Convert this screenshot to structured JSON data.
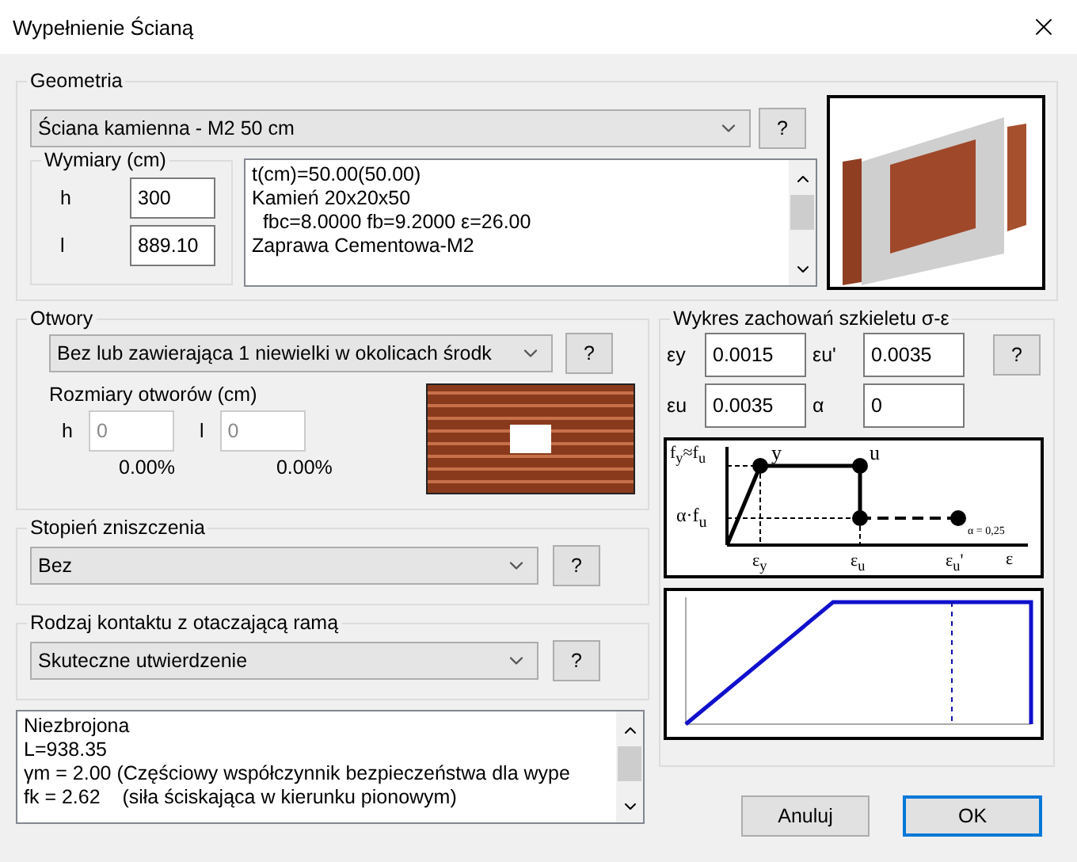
{
  "window": {
    "title": "Wypełnienie Ścianą"
  },
  "geometry": {
    "title": "Geometria",
    "wall_type": "Ściana kamienna - M2 50 cm",
    "help": "?",
    "dimensions": {
      "title": "Wymiary (cm)",
      "fields": [
        {
          "label": "h",
          "value": "300"
        },
        {
          "label": "l",
          "value": "889.10"
        }
      ]
    },
    "properties": [
      "t(cm)=50.00(50.00)",
      "Kamień 20x20x50",
      "  fbc=8.0000 fb=9.2000 ε=26.00",
      "Zaprawa Cementowa-M2"
    ]
  },
  "openings": {
    "title": "Otwory",
    "type": "Bez lub zawierająca 1  niewielki w okolicach środk",
    "help": "?",
    "sizes_title": "Rozmiary otworów (cm)",
    "fields": [
      {
        "label": "h",
        "value": "0",
        "percent": "0.00%",
        "disabled": true
      },
      {
        "label": "l",
        "value": "0",
        "percent": "0.00%",
        "disabled": true
      }
    ]
  },
  "damage": {
    "title": "Stopień zniszczenia",
    "value": "Bez",
    "help": "?"
  },
  "contact": {
    "title": "Rodzaj kontaktu z otaczającą ramą",
    "value": "Skuteczne utwierdzenie",
    "help": "?"
  },
  "notes": [
    "Niezbrojona",
    "L=938.35",
    "γm = 2.00 (Częściowy współczynnik bezpieczeństwa dla wype",
    "fk = 2.62    (siła ściskająca w kierunku pionowym)"
  ],
  "behavior": {
    "title": "Wykres zachowań szkieletu σ-ε",
    "help": "?",
    "fields": [
      {
        "label": "εy",
        "value": "0.0015"
      },
      {
        "label": "εu'",
        "value": "0.0035"
      },
      {
        "label": "εu",
        "value": "0.0035"
      },
      {
        "label": "α",
        "value": "0"
      }
    ],
    "diagram_labels": {
      "fy": "f$_{y}$≈f$_{u}$",
      "y": "y",
      "u": "u",
      "afu": "α·f$_{u}$",
      "ey": "ε$_{y}$",
      "eu": "ε$_{u}$",
      "eu2": "ε$_{u}$'",
      "e": "ε",
      "alpha": "α = 0,25"
    }
  },
  "buttons": [
    {
      "label": "Anuluj",
      "default": false
    },
    {
      "label": "OK",
      "default": true
    }
  ]
}
